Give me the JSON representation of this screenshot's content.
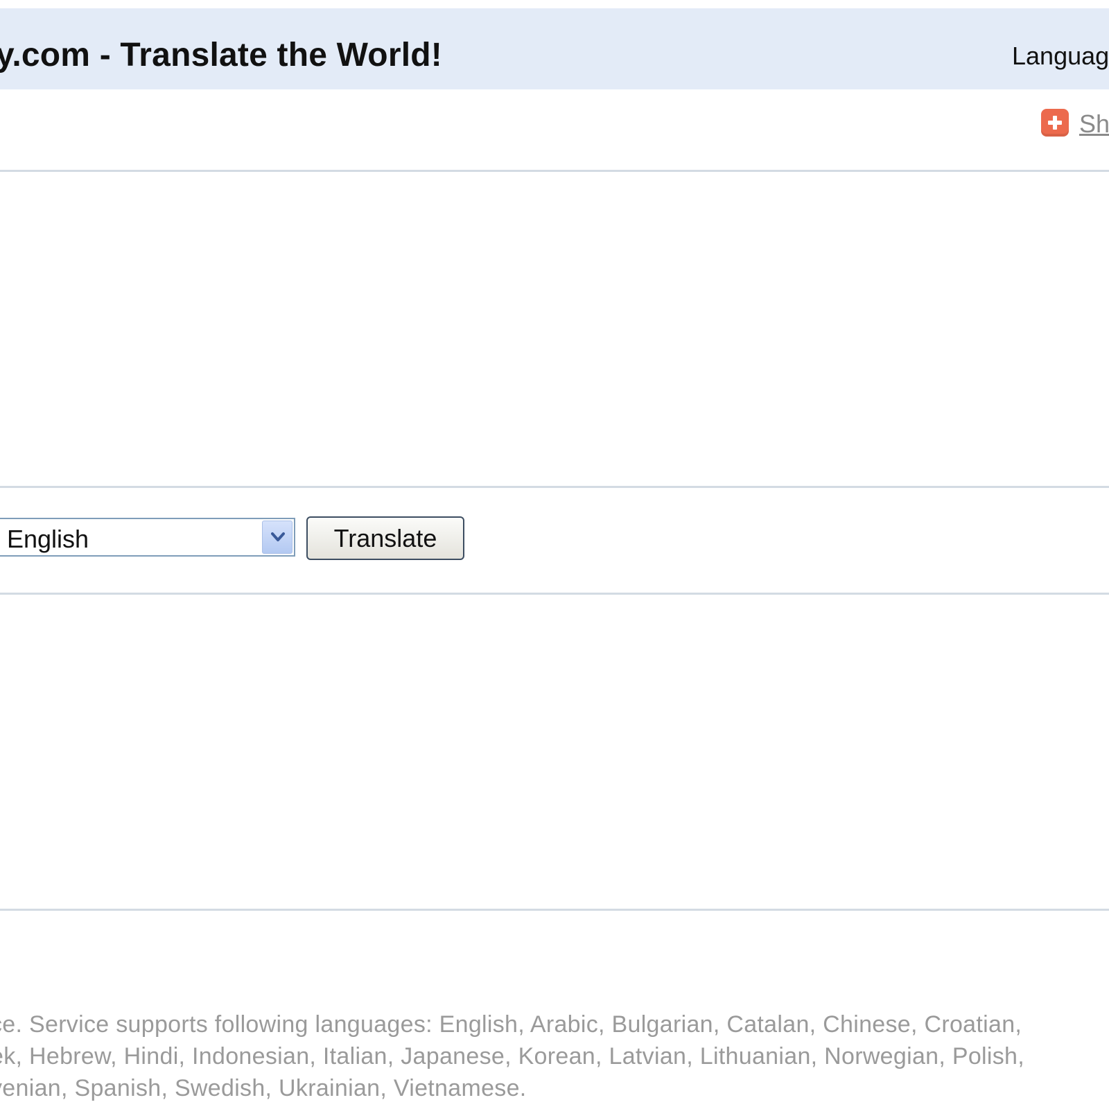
{
  "header": {
    "title": "y.com - Translate the World!",
    "language_label": "Languag"
  },
  "share": {
    "icon": "plus-icon",
    "link_text": "Sh"
  },
  "translator": {
    "source_text": "",
    "target_language": "English",
    "translate_button": "Translate",
    "result_text": ""
  },
  "footer": {
    "lines": [
      "ce. Service supports following languages: English, Arabic, Bulgarian, Catalan, Chinese, Croatian,",
      "ek, Hebrew, Hindi, Indonesian, Italian, Japanese, Korean, Latvian, Lithuanian, Norwegian, Polish,",
      "venian, Spanish, Swedish, Ukrainian, Vietnamese."
    ]
  },
  "colors": {
    "header_bg": "#e3ebf7",
    "divider": "#d3dbe3",
    "share_icon": "#ec6a4d",
    "footer_text": "#9a9a9a"
  }
}
